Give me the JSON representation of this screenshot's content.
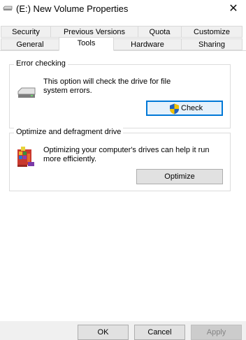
{
  "window": {
    "title": "(E:) New Volume Properties",
    "close_glyph": "✕"
  },
  "tabs_row1": [
    {
      "label": "Security"
    },
    {
      "label": "Previous Versions"
    },
    {
      "label": "Quota"
    },
    {
      "label": "Customize"
    }
  ],
  "tabs_row2": [
    {
      "label": "General"
    },
    {
      "label": "Tools",
      "active": true
    },
    {
      "label": "Hardware"
    },
    {
      "label": "Sharing"
    }
  ],
  "error_checking": {
    "title": "Error checking",
    "description": "This option will check the drive for file system errors.",
    "button": "Check",
    "icon": "drive-icon"
  },
  "optimize": {
    "title": "Optimize and defragment drive",
    "description": "Optimizing your computer's drives can help it run more efficiently.",
    "button": "Optimize",
    "icon": "defrag-icon"
  },
  "footer": {
    "ok": "OK",
    "cancel": "Cancel",
    "apply": "Apply"
  },
  "colors": {
    "accent": "#0078d7",
    "shield_blue": "#1f5fbf",
    "shield_yellow": "#f2c200"
  }
}
